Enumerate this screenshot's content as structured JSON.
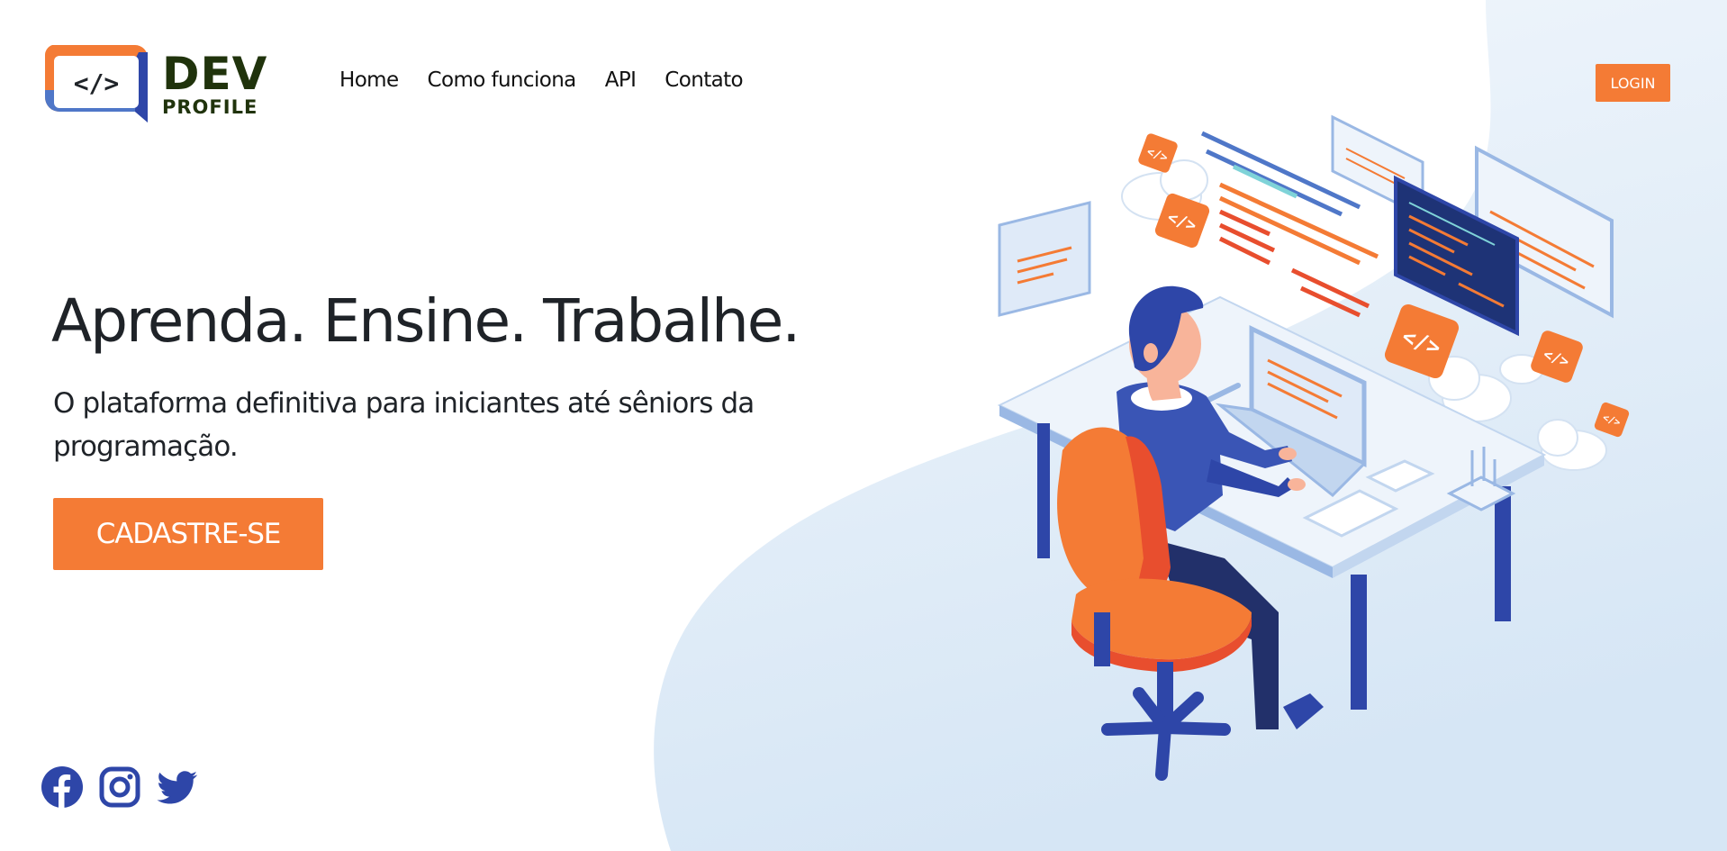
{
  "brand": {
    "code_glyph": "</>",
    "name_top": "DEV",
    "name_bottom": "PROFILE"
  },
  "nav": {
    "items": [
      "Home",
      "Como funciona",
      "API",
      "Contato"
    ]
  },
  "header": {
    "login_label": "LOGIN"
  },
  "hero": {
    "title": "Aprenda. Ensine. Trabalhe.",
    "subtitle": "O plataforma definitiva para iniciantes até sêniors da programação.",
    "cta_label": "CADASTRE-SE"
  },
  "socials": [
    "facebook-icon",
    "instagram-icon",
    "twitter-icon"
  ],
  "colors": {
    "accent": "#f47b35",
    "brand_blue": "#2e46a8",
    "text": "#1f2328",
    "background_blob": "#dce9f6"
  }
}
